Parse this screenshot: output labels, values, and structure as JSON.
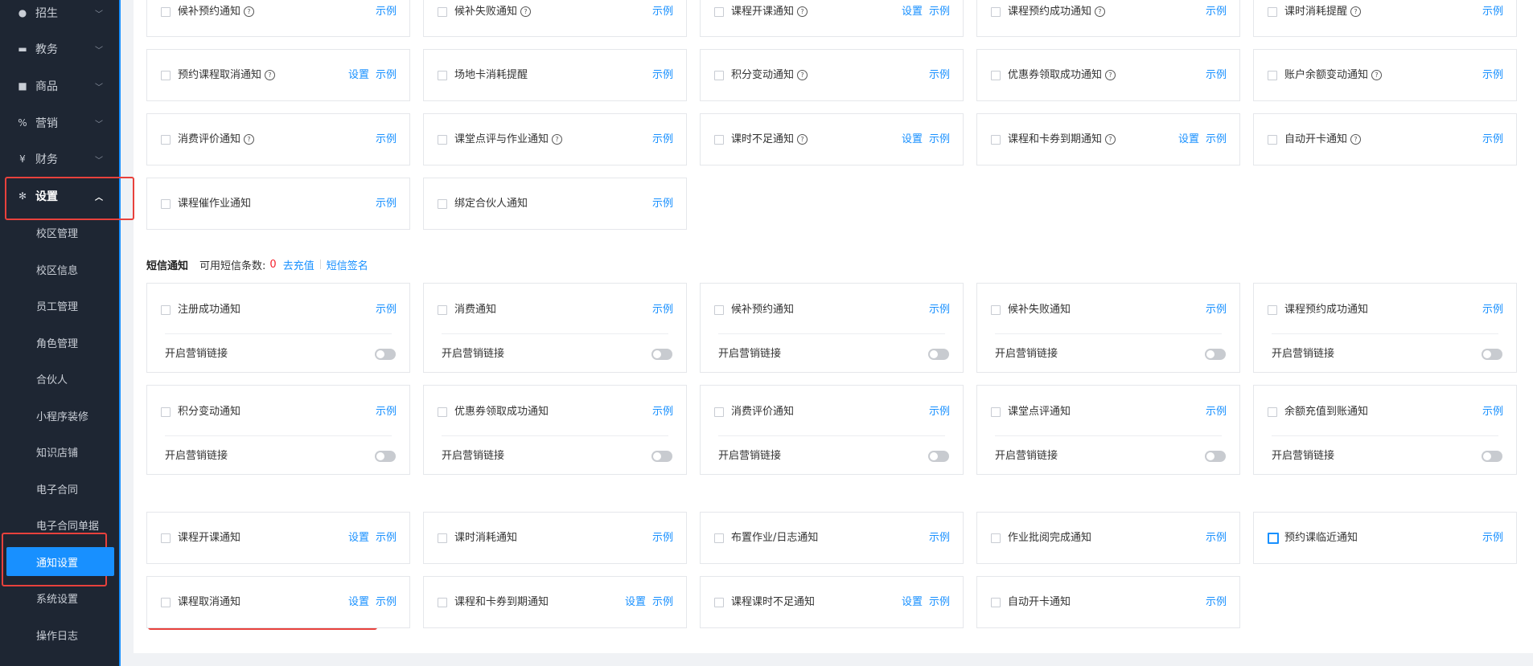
{
  "sidebar": {
    "menus": [
      {
        "label": "招生",
        "icon": "user-icon"
      },
      {
        "label": "教务",
        "icon": "calendar-icon"
      },
      {
        "label": "商品",
        "icon": "bag-icon"
      },
      {
        "label": "营销",
        "icon": "discount-icon"
      },
      {
        "label": "财务",
        "icon": "yen-icon"
      },
      {
        "label": "设置",
        "icon": "gear-icon"
      }
    ],
    "sub_items": [
      "校区管理",
      "校区信息",
      "员工管理",
      "角色管理",
      "合伙人",
      "小程序装修",
      "知识店铺",
      "电子合同",
      "电子合同单据",
      "通知设置",
      "系统设置",
      "操作日志"
    ]
  },
  "wechat_cards": [
    {
      "label": "候补预约通知",
      "help": true,
      "links": [
        "示例"
      ]
    },
    {
      "label": "候补失败通知",
      "help": true,
      "links": [
        "示例"
      ]
    },
    {
      "label": "课程开课通知",
      "help": true,
      "links": [
        "设置",
        "示例"
      ]
    },
    {
      "label": "课程预约成功通知",
      "help": true,
      "links": [
        "示例"
      ]
    },
    {
      "label": "课时消耗提醒",
      "help": true,
      "links": [
        "示例"
      ]
    },
    {
      "label": "预约课程取消通知",
      "help": true,
      "links": [
        "设置",
        "示例"
      ]
    },
    {
      "label": "场地卡消耗提醒",
      "help": false,
      "links": [
        "示例"
      ]
    },
    {
      "label": "积分变动通知",
      "help": true,
      "links": [
        "示例"
      ]
    },
    {
      "label": "优惠券领取成功通知",
      "help": true,
      "links": [
        "示例"
      ]
    },
    {
      "label": "账户余额变动通知",
      "help": true,
      "links": [
        "示例"
      ]
    },
    {
      "label": "消费评价通知",
      "help": true,
      "links": [
        "示例"
      ]
    },
    {
      "label": "课堂点评与作业通知",
      "help": true,
      "links": [
        "示例"
      ]
    },
    {
      "label": "课时不足通知",
      "help": true,
      "links": [
        "设置",
        "示例"
      ]
    },
    {
      "label": "课程和卡券到期通知",
      "help": true,
      "links": [
        "设置",
        "示例"
      ]
    },
    {
      "label": "自动开卡通知",
      "help": true,
      "links": [
        "示例"
      ]
    },
    {
      "label": "课程催作业通知",
      "help": false,
      "links": [
        "示例"
      ]
    },
    {
      "label": "绑定合伙人通知",
      "help": false,
      "links": [
        "示例"
      ]
    }
  ],
  "sms": {
    "title": "短信通知",
    "count_label": "可用短信条数:",
    "count_value": "0",
    "recharge": "去充值",
    "signature": "短信签名",
    "accent_color": "#1890ff",
    "count_color": "#f5222d"
  },
  "sms_cards": [
    {
      "label": "注册成功通知",
      "example": "示例",
      "marketing": "开启营销链接",
      "marketing_on": false
    },
    {
      "label": "消费通知",
      "example": "示例",
      "marketing": "开启营销链接",
      "marketing_on": false
    },
    {
      "label": "候补预约通知",
      "example": "示例",
      "marketing": "开启营销链接",
      "marketing_on": false
    },
    {
      "label": "候补失败通知",
      "example": "示例",
      "marketing": "开启营销链接",
      "marketing_on": false
    },
    {
      "label": "课程预约成功通知",
      "example": "示例",
      "marketing": "开启营销链接",
      "marketing_on": false
    },
    {
      "label": "积分变动通知",
      "example": "示例",
      "marketing": "开启营销链接",
      "marketing_on": false
    },
    {
      "label": "优惠券领取成功通知",
      "example": "示例",
      "marketing": "开启营销链接",
      "marketing_on": false
    },
    {
      "label": "消费评价通知",
      "example": "示例",
      "marketing": "开启营销链接",
      "marketing_on": false
    },
    {
      "label": "课堂点评通知",
      "example": "示例",
      "marketing": "开启营销链接",
      "marketing_on": false
    },
    {
      "label": "余额充值到账通知",
      "example": "示例",
      "marketing": "开启营销链接",
      "marketing_on": false
    }
  ],
  "other_cards": [
    {
      "label": "课程开课通知",
      "links": [
        "设置",
        "示例"
      ],
      "checked_style": false
    },
    {
      "label": "课时消耗通知",
      "links": [
        "示例"
      ],
      "checked_style": false
    },
    {
      "label": "布置作业/日志通知",
      "links": [
        "示例"
      ],
      "checked_style": false
    },
    {
      "label": "作业批阅完成通知",
      "links": [
        "示例"
      ],
      "checked_style": false
    },
    {
      "label": "预约课临近通知",
      "links": [
        "示例"
      ],
      "checked_style": true
    },
    {
      "label": "课程取消通知",
      "links": [
        "设置",
        "示例"
      ],
      "checked_style": false
    },
    {
      "label": "课程和卡券到期通知",
      "links": [
        "设置",
        "示例"
      ],
      "checked_style": false
    },
    {
      "label": "课程课时不足通知",
      "links": [
        "设置",
        "示例"
      ],
      "checked_style": false
    },
    {
      "label": "自动开卡通知",
      "links": [
        "示例"
      ],
      "checked_style": false
    }
  ],
  "colors": {
    "sidebar_bg": "#1e2633",
    "active": "#1890ff",
    "highlight": "#e8413c"
  }
}
